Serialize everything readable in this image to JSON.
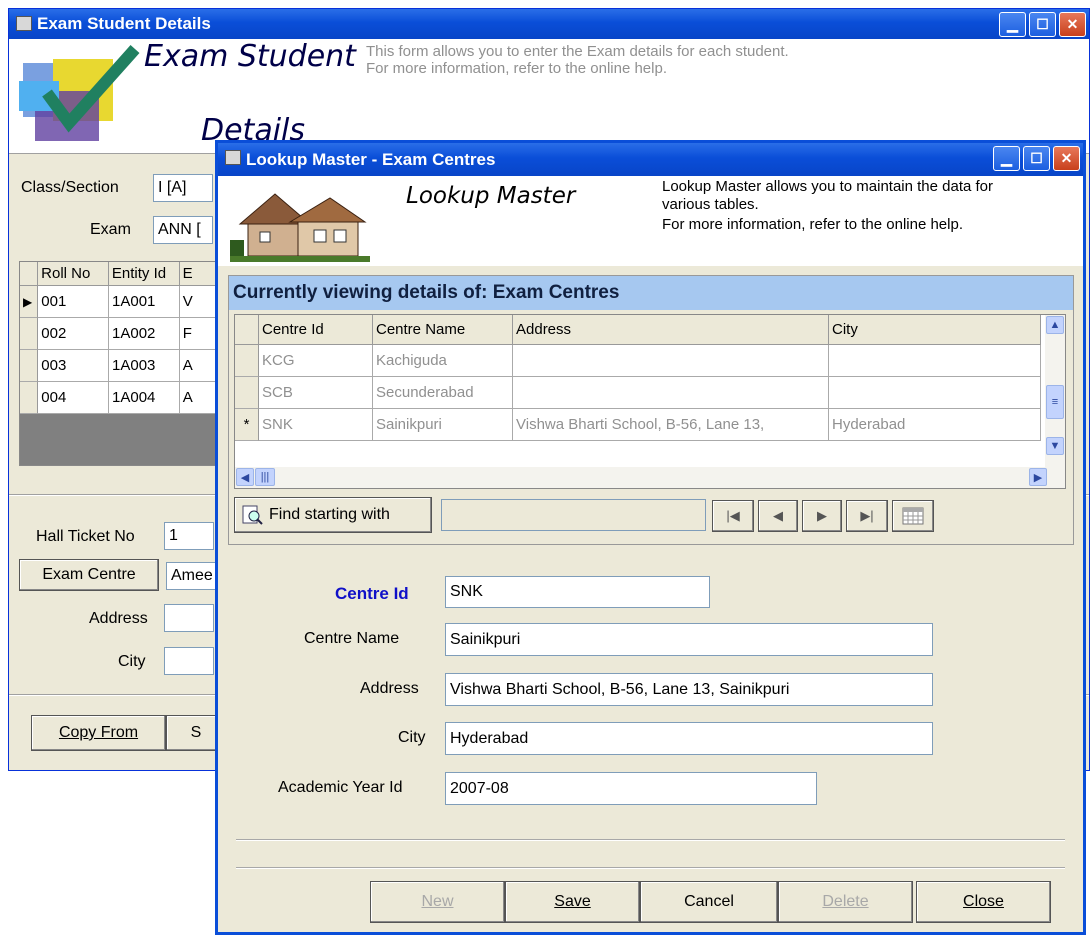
{
  "back_window": {
    "title": "Exam Student Details",
    "banner_title_line1": "Exam Student",
    "banner_title_line2": "Details",
    "banner_desc_line1": "This form allows you to enter the Exam details for each student.",
    "banner_desc_line2": "For more information, refer to the online help.",
    "class_section_label": "Class/Section",
    "class_section_value": "I [A]",
    "exam_label": "Exam",
    "exam_value": "ANN [",
    "grid_headers": [
      "Roll No",
      "Entity Id",
      "E"
    ],
    "grid_rows": [
      {
        "marker": "▶",
        "roll": "001",
        "entity": "1A001",
        "e": "V"
      },
      {
        "marker": "",
        "roll": "002",
        "entity": "1A002",
        "e": "F"
      },
      {
        "marker": "",
        "roll": "003",
        "entity": "1A003",
        "e": "A"
      },
      {
        "marker": "",
        "roll": "004",
        "entity": "1A004",
        "e": "A"
      }
    ],
    "hall_ticket_label": "Hall Ticket No",
    "hall_ticket_value": "1",
    "exam_centre_button": "Exam Centre",
    "exam_centre_value": "Amee",
    "address_label": "Address",
    "city_label": "City",
    "copy_from_button": "Copy From",
    "second_button_partial": "S"
  },
  "lookup_window": {
    "title": "Lookup Master - Exam Centres",
    "banner_title": "Lookup Master",
    "banner_desc_line1": "Lookup Master allows you to maintain the data for",
    "banner_desc_line2": "various tables.",
    "banner_desc_line3": "For more information, refer to the online help.",
    "viewing_header": "Currently viewing details of: Exam Centres",
    "grid_headers": [
      "Centre Id",
      "Centre Name",
      "Address",
      "City"
    ],
    "grid_rows": [
      {
        "marker": "",
        "id": "KCG",
        "name": "Kachiguda",
        "address": "",
        "city": ""
      },
      {
        "marker": "",
        "id": "SCB",
        "name": "Secunderabad",
        "address": "",
        "city": ""
      },
      {
        "marker": "*",
        "id": "SNK",
        "name": "Sainikpuri",
        "address": "Vishwa Bharti School, B-56, Lane 13,",
        "city": "Hyderabad"
      }
    ],
    "find_button": "Find starting with",
    "find_value": "",
    "nav_first": "|◀",
    "nav_prev": "◀",
    "nav_next": "▶",
    "nav_last": "▶|",
    "form": {
      "centre_id_label": "Centre Id",
      "centre_id_value": "SNK",
      "centre_name_label": "Centre Name",
      "centre_name_value": "Sainikpuri",
      "address_label": "Address",
      "address_value": "Vishwa Bharti School, B-56, Lane 13, Sainikpuri",
      "city_label": "City",
      "city_value": "Hyderabad",
      "academic_year_label": "Academic Year Id",
      "academic_year_value": "2007-08"
    },
    "buttons": {
      "new": "New",
      "save": "Save",
      "cancel": "Cancel",
      "delete": "Delete",
      "close": "Close"
    }
  },
  "colors": {
    "titlebar": "#0a4ed8",
    "viewing_header_bg": "#a6c8f0",
    "centre_id_label": "#1010c8"
  }
}
